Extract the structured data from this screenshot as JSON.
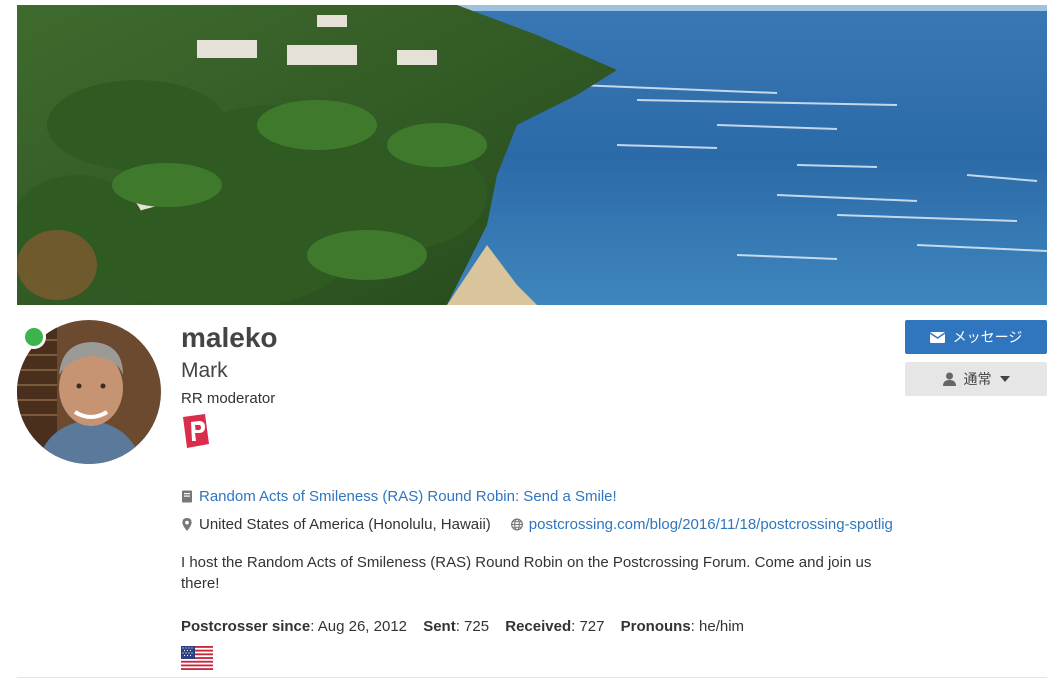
{
  "profile": {
    "username": "maleko",
    "real_name": "Mark",
    "role": "RR moderator",
    "online": true
  },
  "buttons": {
    "message_label": "メッセージ",
    "status_label": "通常"
  },
  "links": {
    "round_robin": "Random Acts of Smileness (RAS) Round Robin: Send a Smile!",
    "location": "United States of America (Honolulu, Hawaii)",
    "website": "postcrossing.com/blog/2016/11/18/postcrossing-spotlig"
  },
  "about": "I host the Random Acts of Smileness (RAS) Round Robin on the Postcrossing Forum. Come and join us there!",
  "stats": {
    "since_label": "Postcrosser since",
    "since_value": ": Aug 26, 2012",
    "sent_label": "Sent",
    "sent_value": ": 725",
    "received_label": "Received",
    "received_value": ": 727",
    "pronouns_label": "Pronouns",
    "pronouns_value": ": he/him"
  },
  "icons": {
    "message": "envelope-icon",
    "status": "user-icon",
    "dropdown": "caret-down-icon",
    "book": "book-icon",
    "location": "map-marker-icon",
    "website": "globe-icon",
    "flag": "us-flag-icon",
    "badge": "postcrossing-p-badge"
  },
  "colors": {
    "accent": "#2f76bf",
    "online": "#3bb54a",
    "badge": "#d92d4c"
  }
}
